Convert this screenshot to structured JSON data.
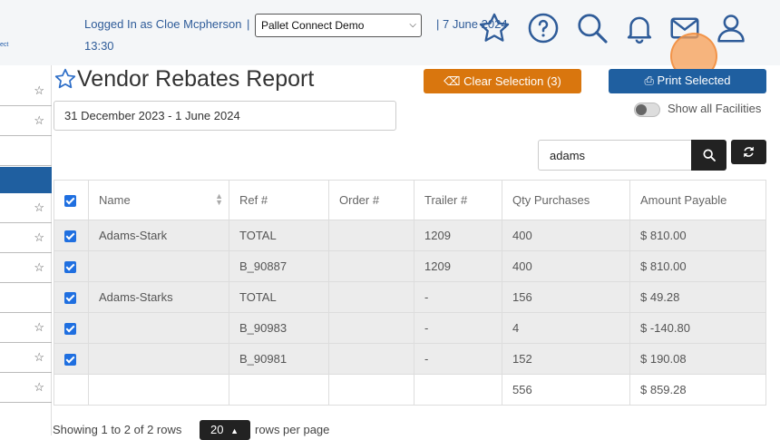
{
  "header": {
    "logo_fragment": "ect",
    "login_text": "Logged In as Cloe Mcpherson",
    "separator": "|",
    "company": "Pallet Connect Demo",
    "date": "| 7 June 2024",
    "time": "13:30"
  },
  "page": {
    "title": "Vendor Rebates Report",
    "clear_button": "Clear Selection (3)",
    "print_button": "Print Selected",
    "date_range": "31 December 2023 - 1 June 2024",
    "toggle_label": "Show all Facilities",
    "toggle_on": false,
    "search_value": "adams"
  },
  "table": {
    "columns": [
      "Name",
      "Ref #",
      "Order #",
      "Trailer #",
      "Qty Purchases",
      "Amount Payable"
    ],
    "rows": [
      {
        "checked": true,
        "name": "Adams-Stark",
        "ref": "TOTAL",
        "order": "",
        "trailer": "1209",
        "qty": "400",
        "amount": "$ 810.00"
      },
      {
        "checked": true,
        "name": "",
        "ref": "B_90887",
        "order": "",
        "trailer": "1209",
        "qty": "400",
        "amount": "$ 810.00"
      },
      {
        "checked": true,
        "name": "Adams-Starks",
        "ref": "TOTAL",
        "order": "",
        "trailer": "-",
        "qty": "156",
        "amount": "$ 49.28"
      },
      {
        "checked": true,
        "name": "",
        "ref": "B_90983",
        "order": "",
        "trailer": "-",
        "qty": "4",
        "amount": "$ -140.80"
      },
      {
        "checked": true,
        "name": "",
        "ref": "B_90981",
        "order": "",
        "trailer": "-",
        "qty": "152",
        "amount": "$ 190.08"
      }
    ],
    "totals": {
      "qty": "556",
      "amount": "$ 859.28"
    }
  },
  "footer": {
    "showing": "Showing 1 to 2 of 2 rows",
    "page_size": "20",
    "rows_per_page": "rows per page"
  },
  "colors": {
    "accent_orange": "#d9760e",
    "accent_blue": "#1f5fa0",
    "checkbox_blue": "#1f6fe0"
  }
}
